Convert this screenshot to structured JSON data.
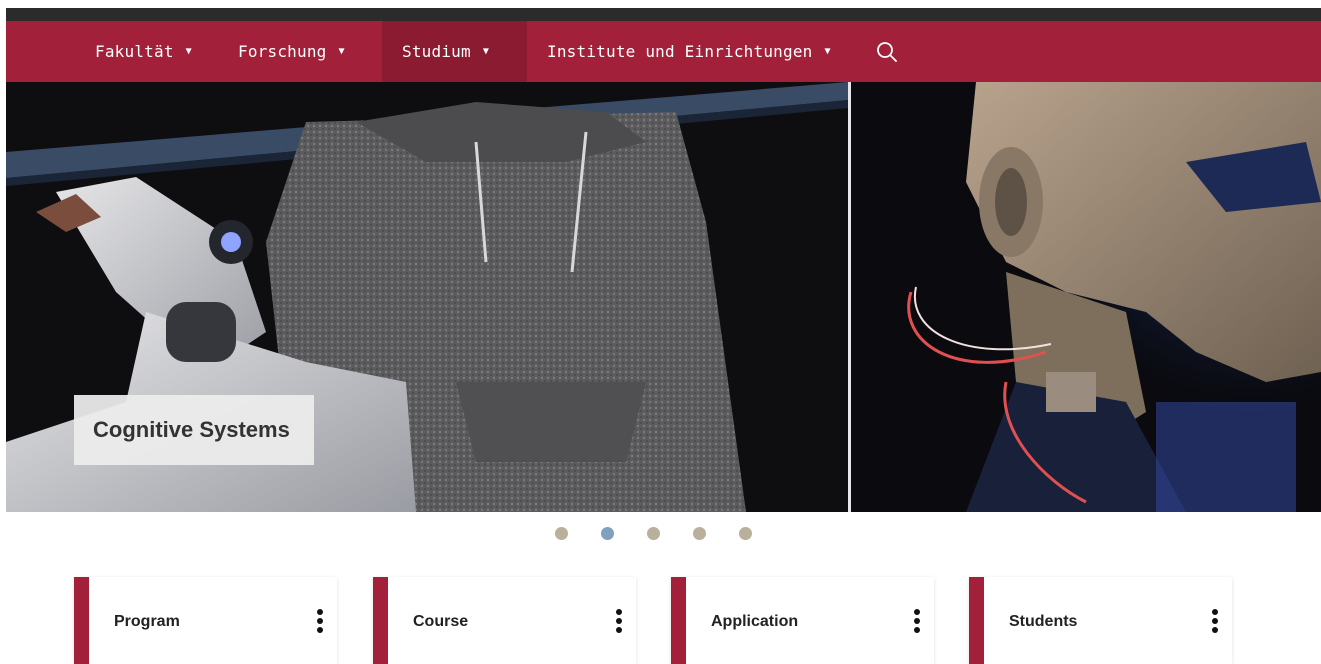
{
  "nav": {
    "items": [
      {
        "label": "Fakultät",
        "caret": "▼"
      },
      {
        "label": "Forschung",
        "caret": "▼"
      },
      {
        "label": "Studium",
        "caret": "▼",
        "active": true
      },
      {
        "label": "Institute und Einrichtungen",
        "caret": "▼"
      }
    ],
    "search_icon": "search-icon"
  },
  "hero": {
    "caption": "Cognitive Systems",
    "slide_count": 5,
    "active_slide": 2
  },
  "cards": [
    {
      "title": "Program"
    },
    {
      "title": "Course"
    },
    {
      "title": "Application"
    },
    {
      "title": "Students"
    }
  ],
  "colors": {
    "brand": "#a3203a",
    "brand_active": "#8a1b30",
    "dot": "#b8b09a",
    "dot_active": "#7fa0bf"
  }
}
